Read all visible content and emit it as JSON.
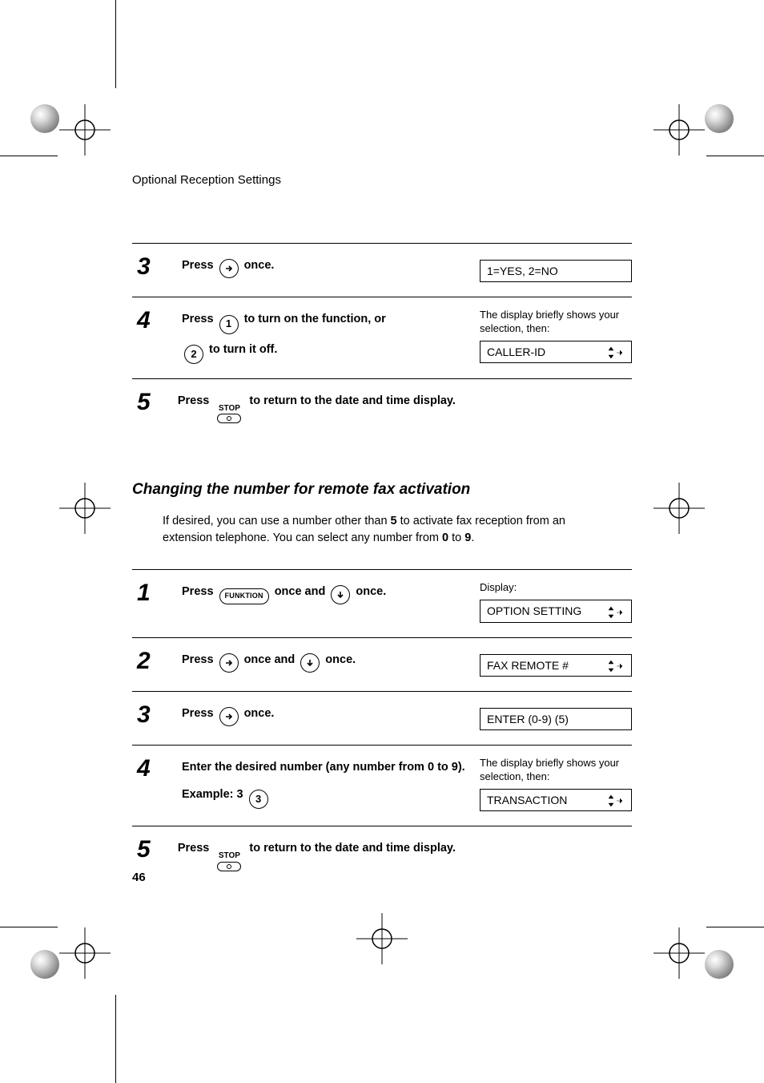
{
  "header": {
    "running_head": "Optional Reception Settings"
  },
  "proc_a": {
    "s3": {
      "num": "3",
      "t1": "Press ",
      "t2": " once.",
      "lcd": "1=YES, 2=NO"
    },
    "s4": {
      "num": "4",
      "t1": "Press ",
      "t2": " to turn on the function, or ",
      "t3": " to turn it off.",
      "note": "The display briefly shows your selection, then:",
      "lcd": "CALLER-ID"
    },
    "s5": {
      "num": "5",
      "t1": "Press ",
      "stop": "STOP",
      "t2": " to return to the date and time display."
    }
  },
  "section": {
    "title": "Changing the number for remote fax activation",
    "para_a": "If desired, you can use a number other than ",
    "bold5": "5",
    "para_b": " to activate fax reception from an extension telephone. You can select any number from ",
    "bold0": "0",
    "para_c": " to ",
    "bold9": "9",
    "para_d": "."
  },
  "proc_b": {
    "s1": {
      "num": "1",
      "t1": "Press ",
      "func": "FUNKTION",
      "t2": " once and ",
      "t3": " once.",
      "note": "Display:",
      "lcd": "OPTION SETTING"
    },
    "s2": {
      "num": "2",
      "t1": "Press ",
      "t2": " once and ",
      "t3": " once.",
      "lcd": "FAX REMOTE #"
    },
    "s3": {
      "num": "3",
      "t1": "Press ",
      "t2": " once.",
      "lcd": "ENTER (0-9) (5)"
    },
    "s4": {
      "num": "4",
      "t1": "Enter the desired number (any number from 0 to 9).",
      "ex_label": "Example: 3 ",
      "ex_key": "3",
      "note": "The display briefly shows your selection, then:",
      "lcd": "TRANSACTION"
    },
    "s5": {
      "num": "5",
      "t1": "Press ",
      "stop": "STOP",
      "t2": " to return to the date and time display."
    }
  },
  "keys": {
    "k1": "1",
    "k2": "2"
  },
  "footer": {
    "page": "46"
  }
}
